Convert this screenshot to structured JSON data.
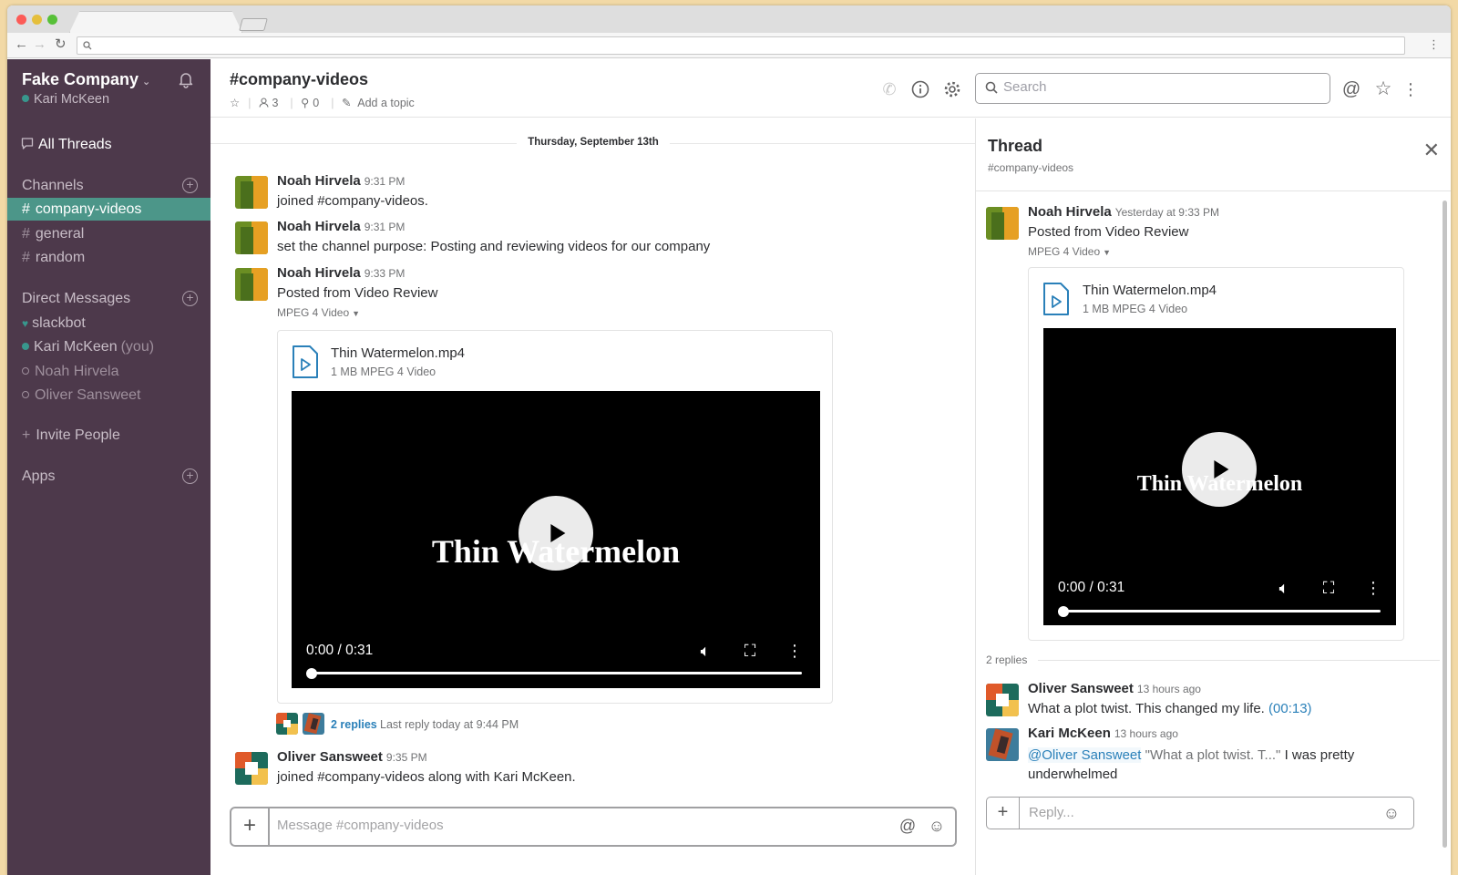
{
  "workspace": {
    "name": "Fake Company",
    "current_user": "Kari McKeen"
  },
  "sidebar": {
    "all_threads": "All Threads",
    "channels_label": "Channels",
    "channels": [
      {
        "name": "company-videos",
        "active": true
      },
      {
        "name": "general",
        "active": false
      },
      {
        "name": "random",
        "active": false
      }
    ],
    "dm_label": "Direct Messages",
    "dms": [
      {
        "name": "slackbot",
        "status": "bot"
      },
      {
        "name": "Kari McKeen",
        "suffix": "(you)",
        "status": "online"
      },
      {
        "name": "Noah Hirvela",
        "status": "away"
      },
      {
        "name": "Oliver Sansweet",
        "status": "away"
      }
    ],
    "invite": "Invite People",
    "apps_label": "Apps"
  },
  "channel": {
    "title": "#company-videos",
    "members": "3",
    "pins": "0",
    "add_topic": "Add a topic",
    "search_placeholder": "Search"
  },
  "messages": {
    "day_divider": "Thursday, September 13th",
    "items": [
      {
        "sender": "Noah Hirvela",
        "time": "9:31 PM",
        "text": "joined #company-videos."
      },
      {
        "sender": "Noah Hirvela",
        "time": "9:31 PM",
        "text": "set the channel purpose: Posting and reviewing videos for our company"
      },
      {
        "sender": "Noah Hirvela",
        "time": "9:33 PM",
        "text": "Posted from Video Review",
        "file_type": "MPEG 4 Video"
      },
      {
        "sender": "Oliver Sansweet",
        "time": "9:35 PM",
        "text": "joined #company-videos along with Kari McKeen."
      }
    ],
    "file": {
      "name": "Thin Watermelon.mp4",
      "meta": "1 MB MPEG 4 Video",
      "video_title": "Thin Watermelon",
      "time": "0:00 / 0:31",
      "progress": 0
    },
    "replies": {
      "count_label": "2 replies",
      "last_reply": "Last reply today at 9:44 PM"
    },
    "composer_placeholder": "Message #company-videos"
  },
  "thread": {
    "title": "Thread",
    "channel": "#company-videos",
    "parent": {
      "sender": "Noah Hirvela",
      "time": "Yesterday at 9:33 PM",
      "text": "Posted from Video Review",
      "file_type": "MPEG 4 Video"
    },
    "replies_count": "2 replies",
    "replies": [
      {
        "sender": "Oliver Sansweet",
        "time": "13 hours ago",
        "text": "What a plot twist. This changed my life.",
        "link": "(00:13)"
      },
      {
        "sender": "Kari McKeen",
        "time": "13 hours ago",
        "mention": "@Oliver Sansweet",
        "quote": "\"What a plot twist. T...\"",
        "text": "I was pretty",
        "text2": "underwhelmed"
      }
    ],
    "reply_placeholder": "Reply..."
  },
  "colors": {
    "sidebar_bg": "#4d394b",
    "active_channel": "#4c9689",
    "link": "#2a80b9",
    "online": "#38978d"
  }
}
